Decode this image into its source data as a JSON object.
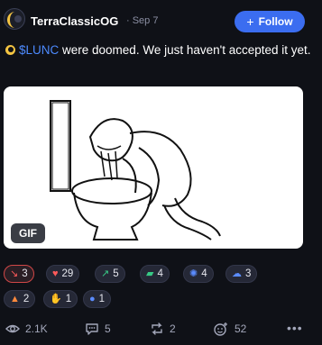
{
  "post": {
    "author": "TerraClassicOG",
    "timestamp": "· Sep 7",
    "follow_label": "Follow",
    "text_cashtag": "$LUNC",
    "text_rest": " were doomed. We just haven't accepted it yet.",
    "media_badge": "GIF"
  },
  "reactions": [
    {
      "icon": "chart-down-icon",
      "glyph": "↘",
      "count": "3",
      "active": true,
      "color": "#ff5a5a"
    },
    {
      "icon": "heart-icon",
      "glyph": "♥",
      "count": "29",
      "active": false,
      "color": "#ff5a5a"
    },
    {
      "icon": "chart-up-icon",
      "glyph": "↗",
      "count": "5",
      "active": false,
      "color": "#38c985"
    },
    {
      "icon": "car-icon",
      "glyph": "▰",
      "count": "4",
      "active": false,
      "color": "#38c985"
    },
    {
      "icon": "octopus-icon",
      "glyph": "✺",
      "count": "4",
      "active": false,
      "color": "#5b8cff"
    },
    {
      "icon": "ghost-icon",
      "glyph": "☁",
      "count": "3",
      "active": false,
      "color": "#5b8cff"
    },
    {
      "icon": "fire-icon",
      "glyph": "▲",
      "count": "2",
      "active": false,
      "color": "#ff8a3d"
    },
    {
      "icon": "hand-icon",
      "glyph": "✋",
      "count": "1",
      "active": false,
      "color": "#f2f2f2"
    },
    {
      "icon": "bomb-icon",
      "glyph": "●",
      "count": "1",
      "active": false,
      "color": "#5b8cff"
    }
  ],
  "stats": {
    "views": "2.1K",
    "comments": "5",
    "reposts": "2",
    "likes": "52"
  },
  "colors": {
    "background": "#0f1117",
    "accent": "#3b6df0",
    "cashtag": "#4d8bff",
    "muted": "#8b8fa3"
  }
}
